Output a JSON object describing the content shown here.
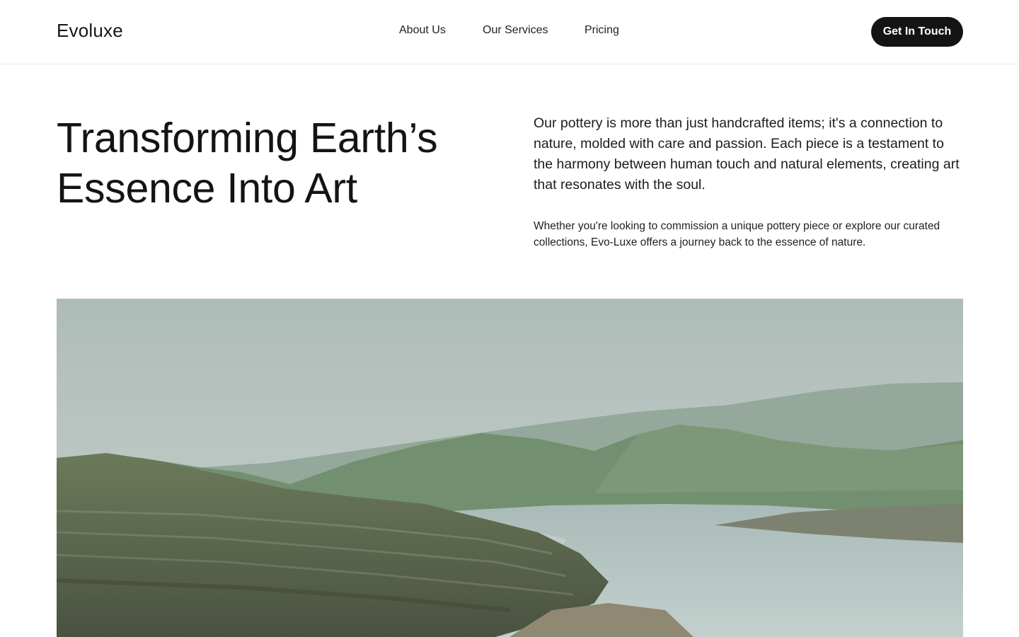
{
  "header": {
    "logo": "Evoluxe",
    "nav": [
      {
        "label": "About Us"
      },
      {
        "label": "Our Services"
      },
      {
        "label": "Pricing"
      }
    ],
    "cta_label": "Get In Touch"
  },
  "hero": {
    "title_line1": "Transforming Earth’s",
    "title_line2": "Essence Into Art",
    "lead": "Our pottery is more than just handcrafted items; it's a connection to nature, molded with care and passion. Each piece is a testament to the harmony between human touch and natural elements, creating art that resonates with the soul.",
    "sub": "Whether you're looking to commission a unique pottery piece or explore our curated collections, Evo-Luxe offers a journey back to the essence of nature."
  },
  "image": {
    "subject": "landscape-photo-lake-and-hills",
    "colors": {
      "sky_top": "#aebcb8",
      "sky_bottom": "#c9d1cc",
      "far_hills": "#8fa59a",
      "mid_hills": "#6f8a6d",
      "near_banks": "#5d6b4f",
      "shore": "#8a8c7a",
      "water": "#b4c5c3"
    }
  }
}
